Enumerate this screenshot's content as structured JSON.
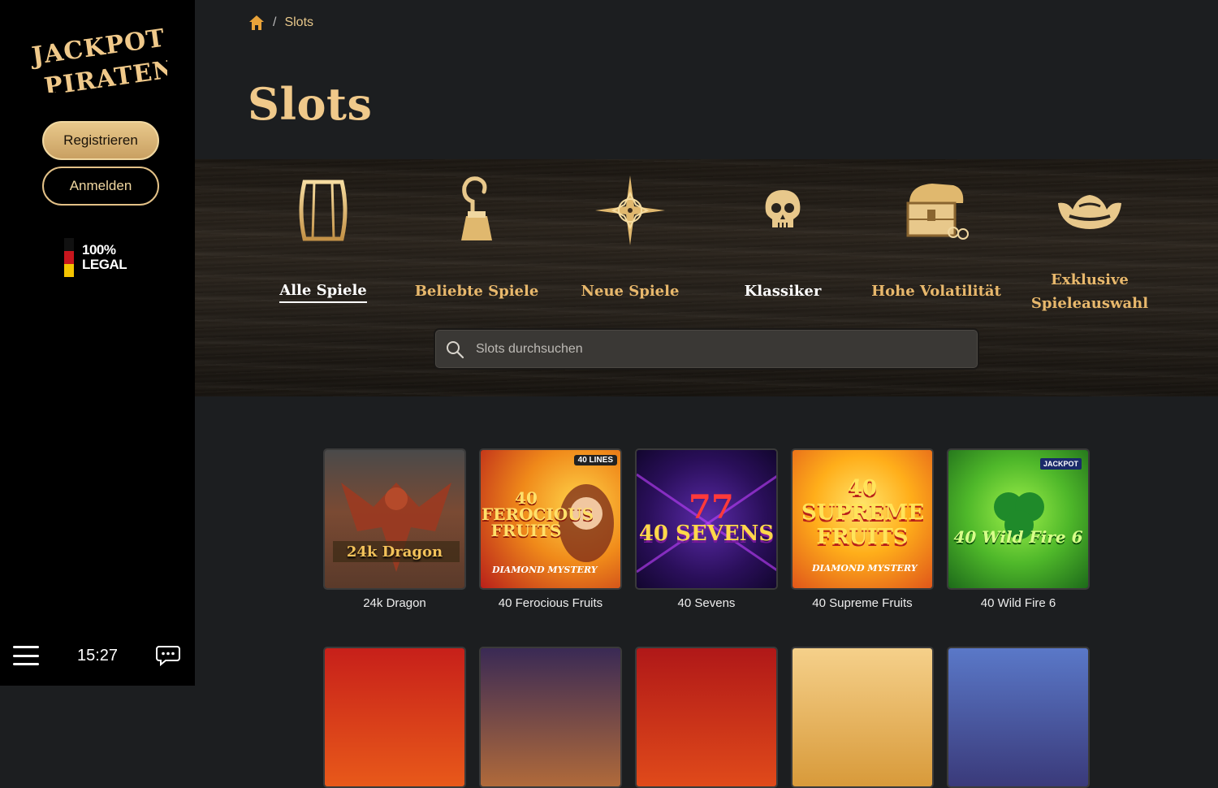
{
  "brand": {
    "logo_text": "JACKPOT PIRATEN"
  },
  "sidebar": {
    "register_label": "Registrieren",
    "login_label": "Anmelden",
    "legal_line1": "100%",
    "legal_line2": "LEGAL",
    "time": "15:27"
  },
  "breadcrumb": {
    "current": "Slots",
    "separator": "/"
  },
  "page": {
    "title": "Slots"
  },
  "categories": [
    {
      "label": "Alle Spiele",
      "icon": "barrel-icon",
      "active": true
    },
    {
      "label": "Beliebte Spiele",
      "icon": "hook-icon"
    },
    {
      "label": "Neue Spiele",
      "icon": "compass-icon"
    },
    {
      "label": "Klassiker",
      "icon": "skull-icon"
    },
    {
      "label": "Hohe Volatilität",
      "icon": "treasure-chest-icon"
    },
    {
      "label": "Exklusive Spieleauswahl",
      "icon": "pirate-hat-icon"
    }
  ],
  "search": {
    "placeholder": "Slots durchsuchen"
  },
  "games": [
    {
      "name": "24k Dragon",
      "art_text": "24k Dragon",
      "colors": [
        "#5a4536",
        "#8a5b3c"
      ]
    },
    {
      "name": "40 Ferocious Fruits",
      "art_text": "40 FEROCIOUS FRUITS",
      "badge": "40 LINES",
      "sub": "DIAMOND MYSTERY",
      "colors": [
        "#f2a21a",
        "#c9271a"
      ]
    },
    {
      "name": "40 Sevens",
      "art_text": "40 SEVENS",
      "colors": [
        "#3b1a6e",
        "#1b0b3c"
      ]
    },
    {
      "name": "40 Supreme Fruits",
      "art_text": "40 SUPREME FRUITS",
      "sub": "DIAMOND MYSTERY",
      "colors": [
        "#ffb21a",
        "#e0561a"
      ]
    },
    {
      "name": "40 Wild Fire 6",
      "art_text": "40 Wild Fire 6",
      "badge": "JACKPOT",
      "colors": [
        "#6fd22a",
        "#1f7a1a"
      ]
    }
  ],
  "games_row2_colors": [
    [
      "#c7201a",
      "#e8591a"
    ],
    [
      "#3a2a55",
      "#b06a3a"
    ],
    [
      "#b01818",
      "#e04a1a"
    ],
    [
      "#f5d08a",
      "#d89a3a"
    ],
    [
      "#5a78c8",
      "#3a3a7a"
    ]
  ],
  "colors": {
    "accent": "#e8c88b",
    "title": "#f0c98a",
    "category": "#e8b86c"
  }
}
